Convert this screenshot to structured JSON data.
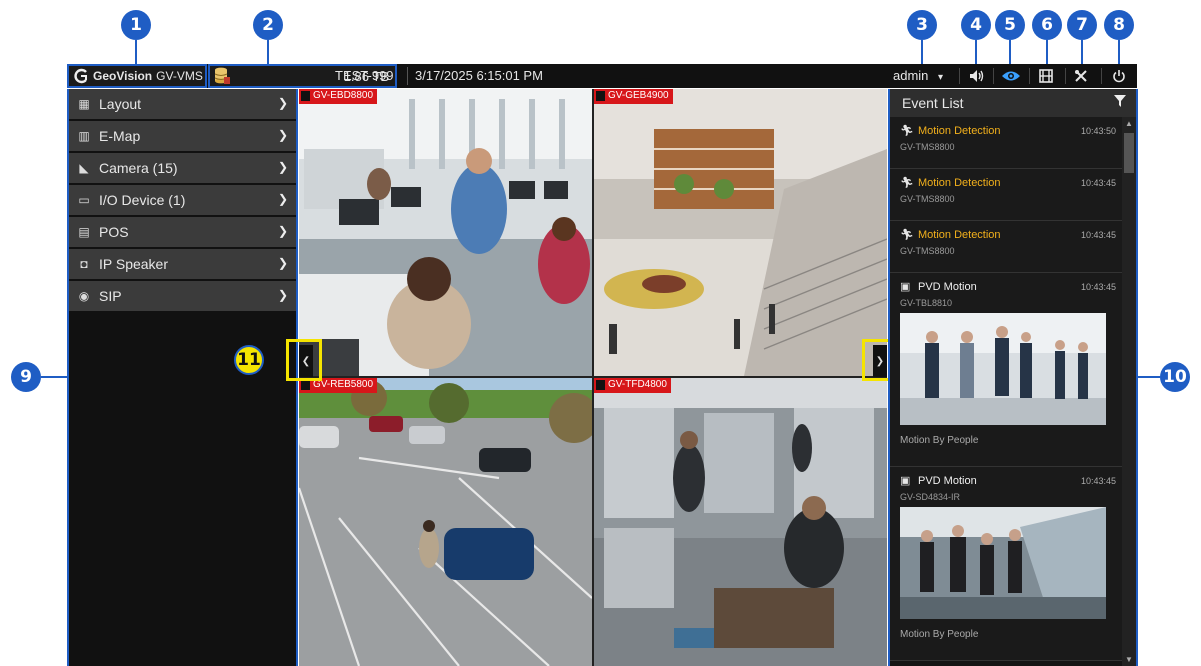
{
  "callouts": [
    "1",
    "2",
    "3",
    "4",
    "5",
    "6",
    "7",
    "8",
    "9",
    "10",
    "11"
  ],
  "topbar": {
    "brand": "GeoVision",
    "product": "GV-VMS",
    "storage": "1.86 TB",
    "host": "TEST-999",
    "datetime": "3/17/2025 6:15:01 PM",
    "user": "admin",
    "user_caret": "▾",
    "icons": [
      "volume-icon",
      "eye-icon",
      "film-icon",
      "tools-icon",
      "power-icon"
    ]
  },
  "sidebar": {
    "items": [
      {
        "label": "Layout",
        "icon": "layout-icon"
      },
      {
        "label": "E-Map",
        "icon": "map-icon"
      },
      {
        "label": "Camera (15)",
        "icon": "camera-icon"
      },
      {
        "label": "I/O Device (1)",
        "icon": "io-device-icon"
      },
      {
        "label": "POS",
        "icon": "pos-icon"
      },
      {
        "label": "IP Speaker",
        "icon": "speaker-icon"
      },
      {
        "label": "SIP",
        "icon": "sip-icon"
      }
    ]
  },
  "cameras": [
    {
      "name": "GV-EBD8800"
    },
    {
      "name": "GV-GEB4900"
    },
    {
      "name": "GV-REB5800"
    },
    {
      "name": "GV-TFD4800"
    }
  ],
  "events": {
    "title": "Event List",
    "items": [
      {
        "type": "Motion Detection",
        "time": "10:43:50",
        "device": "GV-TMS8800"
      },
      {
        "type": "Motion Detection",
        "time": "10:43:45",
        "device": "GV-TMS8800"
      },
      {
        "type": "Motion Detection",
        "time": "10:43:45",
        "device": "GV-TMS8800"
      },
      {
        "type": "PVD Motion",
        "time": "10:43:45",
        "device": "GV-TBL8810",
        "caption": "Motion By People"
      },
      {
        "type": "PVD Motion",
        "time": "10:43:45",
        "device": "GV-SD4834-IR",
        "caption": "Motion By People"
      }
    ]
  }
}
